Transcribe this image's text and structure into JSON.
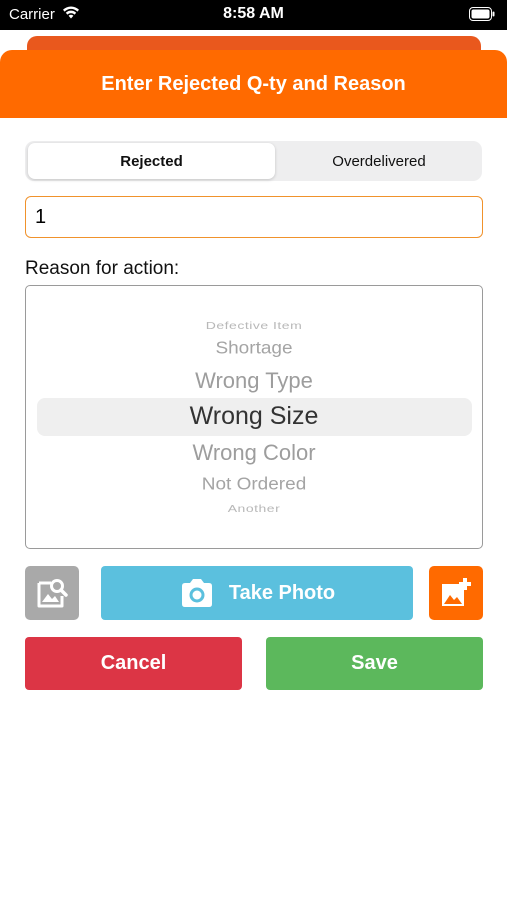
{
  "status_bar": {
    "carrier": "Carrier",
    "time": "8:58 AM"
  },
  "header": {
    "title": "Enter Rejected Q-ty and Reason"
  },
  "segmented": {
    "options": [
      "Rejected",
      "Overdelivered"
    ],
    "selected": "Rejected"
  },
  "quantity": {
    "value": "1"
  },
  "reason": {
    "label": "Reason for action:",
    "options": [
      "Defective Item",
      "Shortage",
      "Wrong Type",
      "Wrong Size",
      "Wrong Color",
      "Not Ordered",
      "Another"
    ],
    "selected": "Wrong Size"
  },
  "actions": {
    "take_photo_label": "Take Photo",
    "cancel_label": "Cancel",
    "save_label": "Save",
    "gallery_icon": "image-search-icon",
    "add_image_icon": "image-plus-icon",
    "camera_icon": "camera-icon"
  },
  "colors": {
    "header": "#ff6a00",
    "take_photo": "#5bc0de",
    "cancel": "#dc3545",
    "save": "#5cb85c",
    "gallery": "#a9a9a9"
  }
}
